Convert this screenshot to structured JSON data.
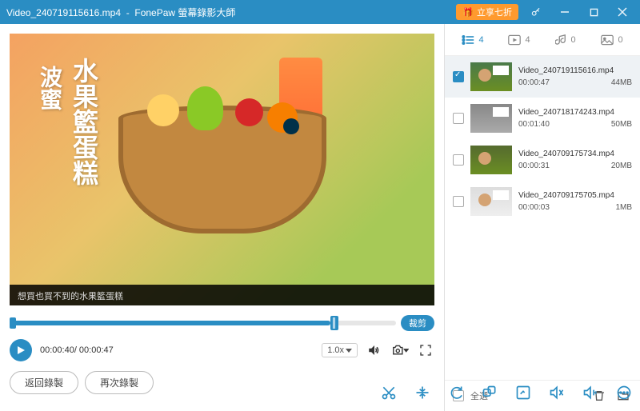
{
  "titlebar": {
    "filename": "Video_240719115616.mp4",
    "app": "FonePaw 螢幕錄影大師",
    "promo": "立享七折"
  },
  "video": {
    "title_line1": "波蜜",
    "title_line2": "水果籃蛋糕",
    "caption": "想買也買不到的水果籃蛋糕"
  },
  "timeline": {
    "trim_label": "裁剪"
  },
  "controls": {
    "time": "00:00:40/ 00:00:47",
    "speed": "1.0x"
  },
  "bottom": {
    "back": "返回錄製",
    "again": "再次錄製"
  },
  "tabs": {
    "list_count": "4",
    "video_count": "4",
    "audio_count": "0",
    "image_count": "0"
  },
  "files": [
    {
      "name": "Video_240719115616.mp4",
      "dur": "00:00:47",
      "size": "44MB"
    },
    {
      "name": "Video_240718174243.mp4",
      "dur": "00:01:40",
      "size": "50MB"
    },
    {
      "name": "Video_240709175734.mp4",
      "dur": "00:00:31",
      "size": "20MB"
    },
    {
      "name": "Video_240709175705.mp4",
      "dur": "00:00:03",
      "size": "1MB"
    }
  ],
  "right_bottom": {
    "select_all": "全選"
  }
}
